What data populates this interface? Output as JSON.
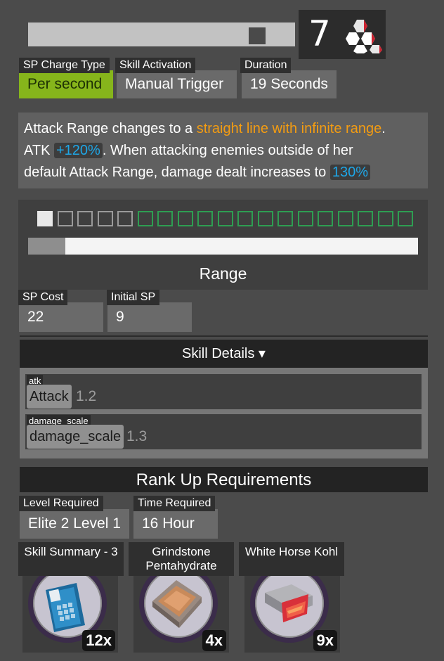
{
  "rank": {
    "level": "7"
  },
  "stats": [
    {
      "label": "SP Charge Type",
      "value": "Per second"
    },
    {
      "label": "Skill Activation",
      "value": "Manual Trigger"
    },
    {
      "label": "Duration",
      "value": "19 Seconds"
    }
  ],
  "description": {
    "p1": "Attack Range changes to a ",
    "p2": "straight line with infinite range",
    "p3": ".",
    "p4": "ATK ",
    "p5": "+120%",
    "p6": ". When attacking enemies outside of her",
    "p7": "default Attack Range, damage dealt increases to ",
    "p8": "130%"
  },
  "range": {
    "label": "Range"
  },
  "sp": [
    {
      "label": "SP Cost",
      "value": "22"
    },
    {
      "label": "Initial SP",
      "value": "9"
    }
  ],
  "details": {
    "header": "Skill Details ▾",
    "params": [
      {
        "key": "atk",
        "name": "Attack",
        "value": "1.2"
      },
      {
        "key": "damage_scale",
        "name": "damage_scale",
        "value": "1.3"
      }
    ]
  },
  "rank_up": {
    "header": "Rank Up Requirements",
    "level_label": "Level Required",
    "level_value": "Elite 2 Level 1",
    "time_label": "Time Required",
    "time_value": "16 Hour"
  },
  "materials": [
    {
      "title": "Skill Summary - 3",
      "qty": "12x"
    },
    {
      "title": "Grindstone Pentahydrate",
      "qty": "4x"
    },
    {
      "title": "White Horse Kohl",
      "qty": "9x"
    }
  ]
}
